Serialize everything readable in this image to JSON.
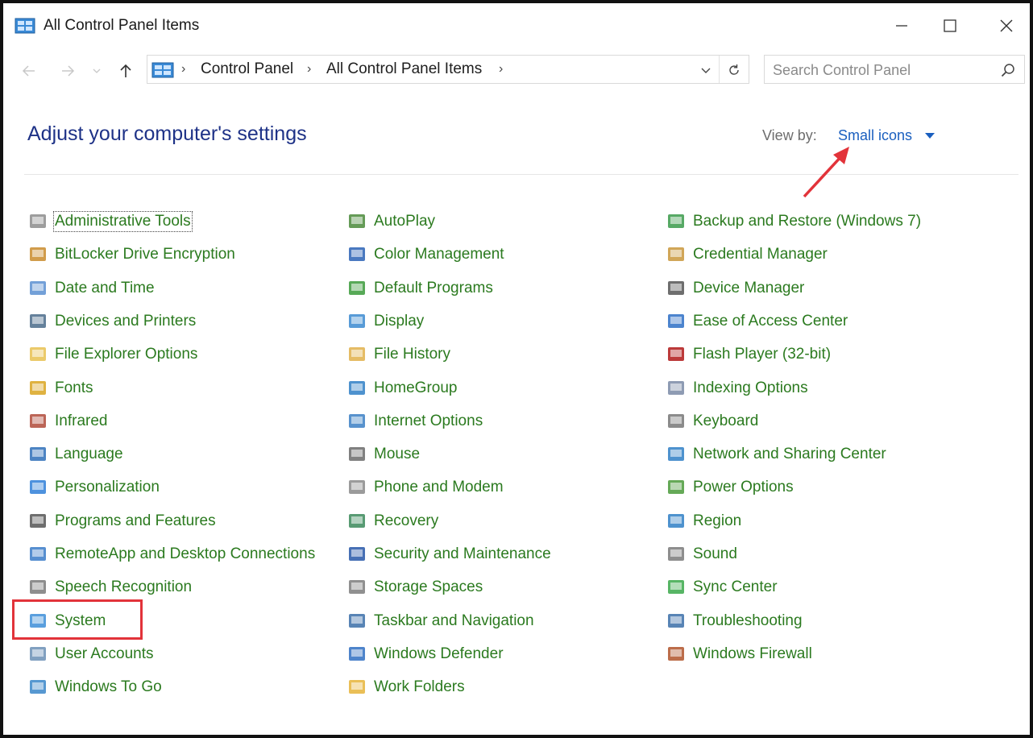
{
  "window": {
    "title": "All Control Panel Items",
    "controls": [
      "minimize",
      "maximize",
      "close"
    ]
  },
  "navigation": {
    "breadcrumbs": [
      "Control Panel",
      "All Control Panel Items"
    ],
    "search": {
      "placeholder": "Search Control Panel",
      "value": ""
    }
  },
  "header": {
    "title": "Adjust your computer's settings",
    "view_by_label": "View by:",
    "view_by_value": "Small icons"
  },
  "columns": [
    [
      {
        "label": "Administrative Tools",
        "icon": "admin-tools-icon"
      },
      {
        "label": "BitLocker Drive Encryption",
        "icon": "bitlocker-icon"
      },
      {
        "label": "Date and Time",
        "icon": "clock-icon"
      },
      {
        "label": "Devices and Printers",
        "icon": "printer-icon"
      },
      {
        "label": "File Explorer Options",
        "icon": "folder-options-icon"
      },
      {
        "label": "Fonts",
        "icon": "fonts-icon"
      },
      {
        "label": "Infrared",
        "icon": "infrared-icon"
      },
      {
        "label": "Language",
        "icon": "language-icon"
      },
      {
        "label": "Personalization",
        "icon": "personalization-icon"
      },
      {
        "label": "Programs and Features",
        "icon": "programs-icon"
      },
      {
        "label": "RemoteApp and Desktop Connections",
        "icon": "remoteapp-icon"
      },
      {
        "label": "Speech Recognition",
        "icon": "microphone-icon"
      },
      {
        "label": "System",
        "icon": "monitor-icon"
      },
      {
        "label": "User Accounts",
        "icon": "users-icon"
      },
      {
        "label": "Windows To Go",
        "icon": "windows-to-go-icon"
      }
    ],
    [
      {
        "label": "AutoPlay",
        "icon": "autoplay-icon"
      },
      {
        "label": "Color Management",
        "icon": "color-management-icon"
      },
      {
        "label": "Default Programs",
        "icon": "default-programs-icon"
      },
      {
        "label": "Display",
        "icon": "display-icon"
      },
      {
        "label": "File History",
        "icon": "file-history-icon"
      },
      {
        "label": "HomeGroup",
        "icon": "homegroup-icon"
      },
      {
        "label": "Internet Options",
        "icon": "globe-icon"
      },
      {
        "label": "Mouse",
        "icon": "mouse-icon"
      },
      {
        "label": "Phone and Modem",
        "icon": "phone-icon"
      },
      {
        "label": "Recovery",
        "icon": "recovery-icon"
      },
      {
        "label": "Security and Maintenance",
        "icon": "flag-icon"
      },
      {
        "label": "Storage Spaces",
        "icon": "storage-icon"
      },
      {
        "label": "Taskbar and Navigation",
        "icon": "taskbar-icon"
      },
      {
        "label": "Windows Defender",
        "icon": "shield-icon"
      },
      {
        "label": "Work Folders",
        "icon": "work-folders-icon"
      }
    ],
    [
      {
        "label": "Backup and Restore (Windows 7)",
        "icon": "backup-icon"
      },
      {
        "label": "Credential Manager",
        "icon": "credential-icon"
      },
      {
        "label": "Device Manager",
        "icon": "device-manager-icon"
      },
      {
        "label": "Ease of Access Center",
        "icon": "accessibility-icon"
      },
      {
        "label": "Flash Player (32-bit)",
        "icon": "flash-icon"
      },
      {
        "label": "Indexing Options",
        "icon": "indexing-icon"
      },
      {
        "label": "Keyboard",
        "icon": "keyboard-icon"
      },
      {
        "label": "Network and Sharing Center",
        "icon": "network-icon"
      },
      {
        "label": "Power Options",
        "icon": "power-icon"
      },
      {
        "label": "Region",
        "icon": "region-icon"
      },
      {
        "label": "Sound",
        "icon": "speaker-icon"
      },
      {
        "label": "Sync Center",
        "icon": "sync-icon"
      },
      {
        "label": "Troubleshooting",
        "icon": "troubleshooting-icon"
      },
      {
        "label": "Windows Firewall",
        "icon": "firewall-icon"
      }
    ]
  ],
  "colors": {
    "link_green": "#2b7a1f",
    "title_blue": "#1e3287",
    "view_blue": "#1a5fbf",
    "annotation_red": "#e2333a"
  },
  "annotations": {
    "highlighted_item": "System",
    "arrow_target": "Small icons"
  }
}
